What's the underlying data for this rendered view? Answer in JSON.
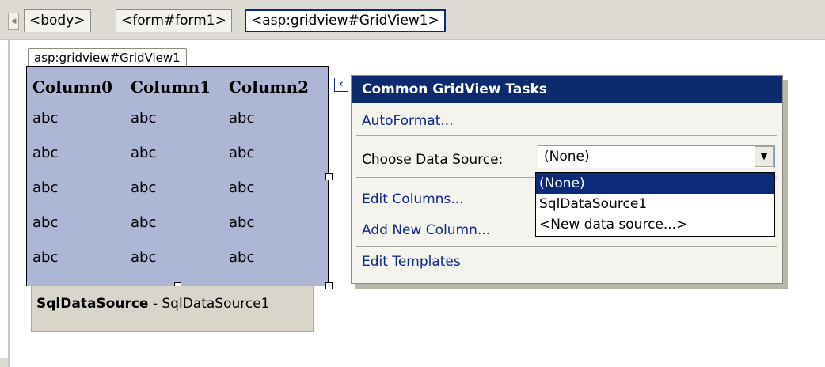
{
  "tag_bar": {
    "scroll_icon": "chevron-left-icon",
    "tags": [
      "<body>",
      "<form#form1>",
      "<asp:gridview#GridView1>"
    ]
  },
  "gridview": {
    "tab_label": "asp:gridview#GridView1",
    "columns": [
      "Column0",
      "Column1",
      "Column2"
    ],
    "rows": [
      [
        "abc",
        "abc",
        "abc"
      ],
      [
        "abc",
        "abc",
        "abc"
      ],
      [
        "abc",
        "abc",
        "abc"
      ],
      [
        "abc",
        "abc",
        "abc"
      ],
      [
        "abc",
        "abc",
        "abc"
      ]
    ]
  },
  "sql_datasource": {
    "type_label": "SqlDataSource",
    "separator": " - ",
    "id": "SqlDataSource1"
  },
  "smart_tag": {
    "icon": "chevron-left-icon"
  },
  "task_panel": {
    "title": "Common GridView Tasks",
    "autoformat": "AutoFormat...",
    "choose_ds_label": "Choose Data Source:",
    "choose_ds_value": "(None)",
    "dropdown_icon": "dropdown-arrow-icon",
    "ds_options": [
      "(None)",
      "SqlDataSource1",
      "<New data source...>"
    ],
    "edit_columns": "Edit Columns...",
    "add_column": "Add New Column...",
    "edit_templates": "Edit Templates"
  },
  "colors": {
    "header_bg": "#0d2a6e",
    "grid_bg": "#aeb6d6",
    "link": "#0b2a8a",
    "selected_option": "#0b2a78"
  }
}
